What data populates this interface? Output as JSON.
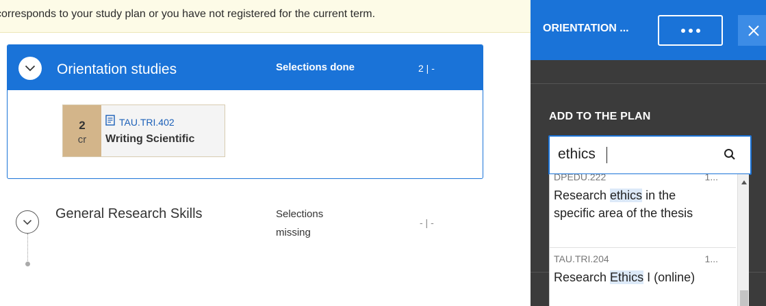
{
  "notice": {
    "text": "corresponds to your study plan or you have not registered for the current term."
  },
  "orientation": {
    "title": "Orientation studies",
    "status": "Selections done",
    "credits": "2 | -",
    "course": {
      "credit_value": "2",
      "credit_unit": "cr",
      "code": "TAU.TRI.402",
      "name": "Writing Scientific"
    }
  },
  "general": {
    "title": "General Research Skills",
    "status": "Selections missing",
    "credits": "- | -"
  },
  "panel": {
    "title": "ORIENTATION ...",
    "add_label": "ADD TO THE PLAN",
    "search_value": "ethics",
    "results": [
      {
        "code": "DPEDU.222",
        "credits": "1...",
        "name_before": "Research ",
        "name_highlight": "ethics",
        "name_after": " in the specific area of the thesis"
      },
      {
        "code": "TAU.TRI.204",
        "credits": "1...",
        "name_before": "Research ",
        "name_highlight": "Ethics",
        "name_after": " I (online)"
      }
    ]
  },
  "colors": {
    "accent": "#1a73d8",
    "panel_bg": "#3b3b3b",
    "credit_box": "#d3b58a",
    "notice_bg": "#fdfbe7"
  },
  "icons": {
    "chevron": "chevron-down-icon",
    "course": "document-icon",
    "more": "more-dots-icon",
    "close": "close-icon",
    "search": "search-icon"
  }
}
